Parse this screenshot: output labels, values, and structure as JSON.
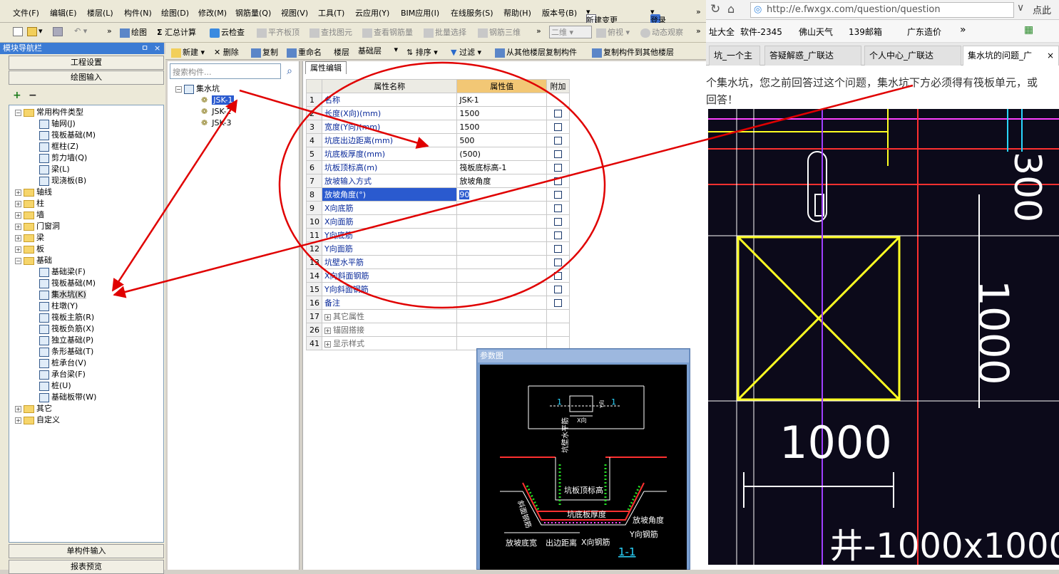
{
  "menu": [
    "文件(F)",
    "编辑(E)",
    "楼层(L)",
    "构件(N)",
    "绘图(D)",
    "修改(M)",
    "钢筋量(Q)",
    "视图(V)",
    "工具(T)",
    "云应用(Y)",
    "BIM应用(I)",
    "在线服务(S)",
    "帮助(H)",
    "版本号(B)",
    "新建变更",
    "登录"
  ],
  "toolbar1": {
    "more": "»",
    "draw": "绘图",
    "sum": "汇总计算",
    "cloud_check": "云检查",
    "flat_top": "平齐板顶",
    "find_elem": "查找图元",
    "view_rebar": "查看钢筋量",
    "batch_select": "批量选择",
    "rebar_3d": "钢筋三维",
    "view_mode": "二维",
    "view_dir": "俯视",
    "dynamic": "动态观察"
  },
  "nav": {
    "title": "模块导航栏",
    "pin": "ㅁ",
    "close": "×",
    "project_settings": "工程设置",
    "draw_input": "绘图输入",
    "single_input": "单构件输入",
    "report": "报表预览",
    "tree": [
      {
        "label": "常用构件类型",
        "type": "folder",
        "open": true,
        "level": 0
      },
      {
        "label": "轴网(J)",
        "type": "item",
        "level": 1
      },
      {
        "label": "筏板基础(M)",
        "type": "item",
        "level": 1
      },
      {
        "label": "框柱(Z)",
        "type": "item",
        "level": 1
      },
      {
        "label": "剪力墙(Q)",
        "type": "item",
        "level": 1
      },
      {
        "label": "梁(L)",
        "type": "item",
        "level": 1
      },
      {
        "label": "现浇板(B)",
        "type": "item",
        "level": 1
      },
      {
        "label": "轴线",
        "type": "folder",
        "open": false,
        "level": 0
      },
      {
        "label": "柱",
        "type": "folder",
        "open": false,
        "level": 0
      },
      {
        "label": "墙",
        "type": "folder",
        "open": false,
        "level": 0
      },
      {
        "label": "门窗洞",
        "type": "folder",
        "open": false,
        "level": 0
      },
      {
        "label": "梁",
        "type": "folder",
        "open": false,
        "level": 0
      },
      {
        "label": "板",
        "type": "folder",
        "open": false,
        "level": 0
      },
      {
        "label": "基础",
        "type": "folder",
        "open": true,
        "level": 0
      },
      {
        "label": "基础梁(F)",
        "type": "item",
        "level": 1
      },
      {
        "label": "筏板基础(M)",
        "type": "item",
        "level": 1
      },
      {
        "label": "集水坑(K)",
        "type": "item",
        "level": 1,
        "selected": true
      },
      {
        "label": "柱墩(Y)",
        "type": "item",
        "level": 1
      },
      {
        "label": "筏板主筋(R)",
        "type": "item",
        "level": 1
      },
      {
        "label": "筏板负筋(X)",
        "type": "item",
        "level": 1
      },
      {
        "label": "独立基础(P)",
        "type": "item",
        "level": 1
      },
      {
        "label": "条形基础(T)",
        "type": "item",
        "level": 1
      },
      {
        "label": "桩承台(V)",
        "type": "item",
        "level": 1
      },
      {
        "label": "承台梁(F)",
        "type": "item",
        "level": 1
      },
      {
        "label": "桩(U)",
        "type": "item",
        "level": 1
      },
      {
        "label": "基础板带(W)",
        "type": "item",
        "level": 1
      },
      {
        "label": "其它",
        "type": "folder",
        "open": false,
        "level": 0
      },
      {
        "label": "自定义",
        "type": "folder",
        "open": false,
        "level": 0
      }
    ]
  },
  "toolbar2": {
    "new": "新建",
    "delete": "删除",
    "copy": "复制",
    "rename": "重命名",
    "floor_label": "楼层",
    "floor_value": "基础层",
    "sort": "排序",
    "filter": "过滤",
    "copy_from": "从其他楼层复制构件",
    "copy_to": "复制构件到其他楼层"
  },
  "components": {
    "search_placeholder": "搜索构件...",
    "root": "集水坑",
    "items": [
      "JSK-1",
      "JSK-2",
      "JSK-3"
    ]
  },
  "props": {
    "tab": "属性编辑",
    "headers": [
      "属性名称",
      "属性值",
      "附加"
    ],
    "rows": [
      {
        "n": "1",
        "name": "名称",
        "value": "JSK-1",
        "check": false
      },
      {
        "n": "2",
        "name": "长度(X向)(mm)",
        "value": "1500",
        "check": true
      },
      {
        "n": "3",
        "name": "宽度(Y向)(mm)",
        "value": "1500",
        "check": true
      },
      {
        "n": "4",
        "name": "坑底出边距离(mm)",
        "value": "500",
        "check": true
      },
      {
        "n": "5",
        "name": "坑底板厚度(mm)",
        "value": "(500)",
        "check": true
      },
      {
        "n": "6",
        "name": "坑板顶标高(m)",
        "value": "筏板底标高-1",
        "check": true
      },
      {
        "n": "7",
        "name": "放坡输入方式",
        "value": "放坡角度",
        "check": true
      },
      {
        "n": "8",
        "name": "放坡角度(°)",
        "value": "90",
        "check": true,
        "selected": true
      },
      {
        "n": "9",
        "name": "X向底筋",
        "value": "",
        "check": true
      },
      {
        "n": "10",
        "name": "X向面筋",
        "value": "",
        "check": true
      },
      {
        "n": "11",
        "name": "Y向底筋",
        "value": "",
        "check": true
      },
      {
        "n": "12",
        "name": "Y向面筋",
        "value": "",
        "check": true
      },
      {
        "n": "13",
        "name": "坑壁水平筋",
        "value": "",
        "check": true
      },
      {
        "n": "14",
        "name": "X向斜面钢筋",
        "value": "",
        "check": true
      },
      {
        "n": "15",
        "name": "Y向斜面钢筋",
        "value": "",
        "check": true
      },
      {
        "n": "16",
        "name": "备注",
        "value": "",
        "check": true
      },
      {
        "n": "17",
        "name": "其它属性",
        "value": "",
        "group": true
      },
      {
        "n": "26",
        "name": "锚固搭接",
        "value": "",
        "group": true
      },
      {
        "n": "41",
        "name": "显示样式",
        "value": "",
        "group": true
      }
    ]
  },
  "ref": {
    "title": "参数图",
    "labels": {
      "sec1": "1",
      "sec1b": "1",
      "xdir": "X向",
      "ydir": "Y向",
      "wall": "坑壁水平筋",
      "top": "坑板顶标高",
      "thick": "坑底板厚度",
      "angle": "放坡角度",
      "yrebar": "Y向钢筋",
      "xrebar": "X向钢筋",
      "width": "放坡底宽",
      "edge": "出边距离",
      "slope": "斜面钢筋",
      "section": "1-1"
    }
  },
  "browser": {
    "url": "http://e.fwxgx.com/question/question",
    "cut": "点此",
    "bookmarks": [
      "址大全",
      "软件-2345",
      "佛山天气",
      "139邮箱",
      "广东造价"
    ],
    "bm_more": "»",
    "tabs": [
      "坑_一个主",
      "答疑解惑_广联达",
      "个人中心_广联达",
      "集水坑的问题_广"
    ],
    "text1": "个集水坑，您之前回答过这个问题，集水坑下方必须得有筏板单元，或",
    "text2": "回答！"
  },
  "cad": {
    "dim1": "300",
    "dim2": "1000",
    "dim3": "1000",
    "label": "井-1000x1000"
  },
  "colors": {
    "accent": "#2a5acf",
    "annotation": "#e00000",
    "cad_yellow": "#ffff22",
    "cad_bg": "#0c0a1a"
  }
}
